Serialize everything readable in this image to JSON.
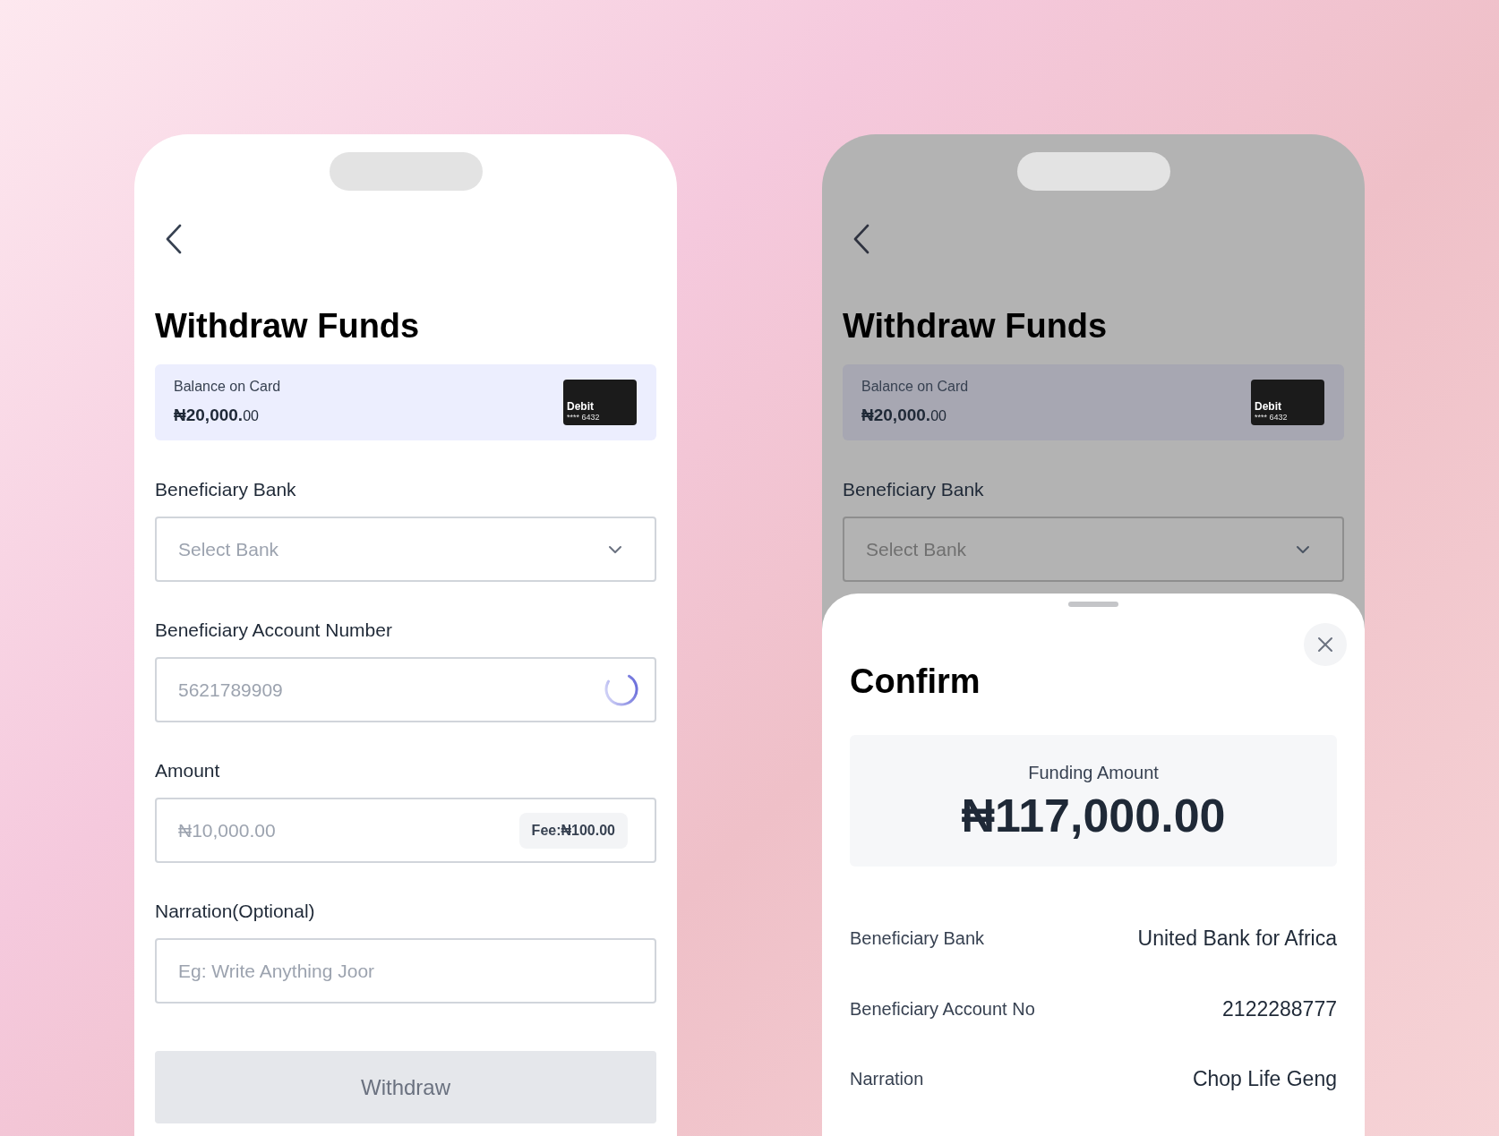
{
  "screens": [
    {
      "dimmed": false,
      "title": "Withdraw Funds",
      "balance": {
        "label": "Balance on Card",
        "amount": "₦20,000.",
        "decimals": "00",
        "card": {
          "type": "Debit",
          "number": "**** 6432"
        }
      },
      "fields": [
        {
          "kind": "select",
          "label": "Beneficiary Bank",
          "placeholder": "Select Bank"
        },
        {
          "kind": "input",
          "label": "Beneficiary Account Number",
          "placeholder": "5621789909",
          "loading": true
        },
        {
          "kind": "input",
          "label": "Amount",
          "placeholder": "₦10,000.00",
          "fee": "Fee:₦100.00",
          "loading": false
        },
        {
          "kind": "input",
          "label": "Narration(Optional)",
          "placeholder": "Eg: Write Anything Joor",
          "loading": false
        }
      ],
      "button": {
        "label": "Withdraw",
        "disabled": true
      }
    },
    {
      "dimmed": true,
      "title": "Withdraw Funds",
      "balance": {
        "label": "Balance on Card",
        "amount": "₦20,000.",
        "decimals": "00",
        "card": {
          "type": "Debit",
          "number": "**** 6432"
        }
      },
      "fields": [
        {
          "kind": "select",
          "label": "Beneficiary Bank",
          "placeholder": "Select Bank"
        }
      ],
      "sheet": {
        "title": "Confirm",
        "amount_label": "Funding Amount",
        "amount": "₦117,000.00",
        "rows": [
          {
            "label": "Beneficiary Bank",
            "value": "United Bank for Africa"
          },
          {
            "label": "Beneficiary Account No",
            "value": "2122288777"
          },
          {
            "label": "Narration",
            "value": "Chop Life Geng"
          }
        ]
      }
    }
  ]
}
